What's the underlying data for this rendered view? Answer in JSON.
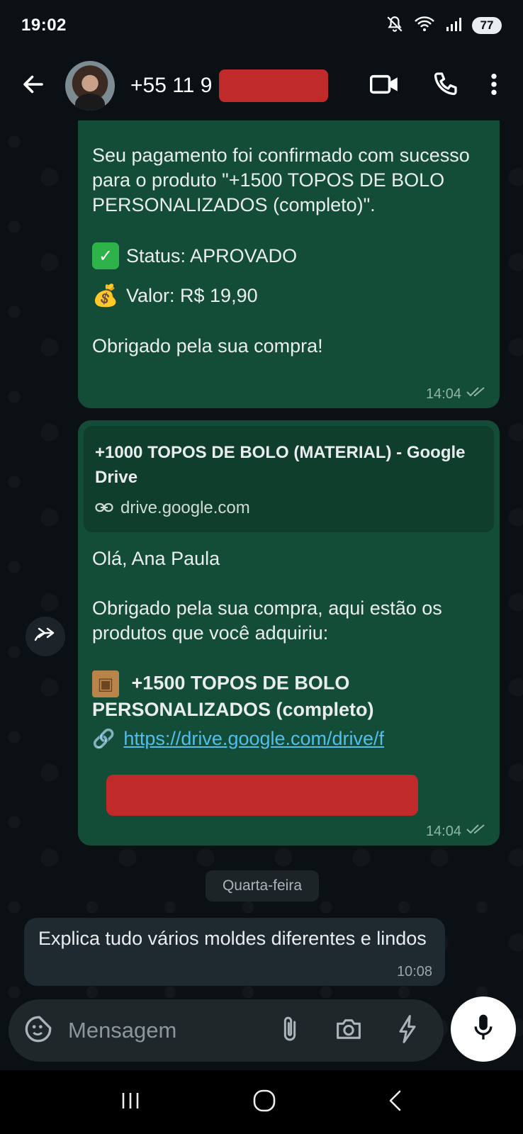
{
  "status_bar": {
    "time": "19:02",
    "battery": "77",
    "signal_label": "5"
  },
  "header": {
    "contact_name": "+55 11 9"
  },
  "messages": {
    "msg1": {
      "para1": "Seu pagamento foi confirmado com sucesso para o produto \"+1500 TOPOS DE BOLO PERSONALIZADOS (completo)\".",
      "status": "Status: APROVADO",
      "valor": "Valor: R$ 19,90",
      "thanks": "Obrigado pela sua compra!",
      "time": "14:04"
    },
    "msg2": {
      "preview_title": "+1000 TOPOS DE BOLO (MATERIAL) - Google Drive",
      "preview_domain": "drive.google.com",
      "greeting": "Olá, Ana Paula",
      "body": "Obrigado pela sua compra, aqui estão os produtos que você adquiriu:",
      "product": "+1500 TOPOS DE BOLO PERSONALIZADOS (completo)",
      "link": "https://drive.google.com/drive/f",
      "time": "14:04"
    },
    "date_chip": "Quarta-feira",
    "msg3": {
      "text": "Explica tudo vários moldes diferentes e lindos",
      "time": "10:08"
    }
  },
  "composer": {
    "placeholder": "Mensagem"
  },
  "icons": {
    "back": "arrow-left-icon",
    "video": "video-call-icon",
    "call": "phone-icon",
    "menu": "more-vert-icon",
    "check": "check-mark-emoji",
    "bag": "money-bag-emoji",
    "box": "package-emoji",
    "link": "link-emoji",
    "ticks": "double-check-icon",
    "forward": "forward-icon",
    "sticker": "sticker-icon",
    "attach": "paperclip-icon",
    "camera": "camera-icon",
    "bolt": "lightning-icon",
    "mic": "mic-icon"
  },
  "colors": {
    "outgoing": "#144d37",
    "incoming": "#1f2a30",
    "link": "#53bdeb",
    "background": "#0b1014",
    "redaction": "#c02a2a"
  }
}
